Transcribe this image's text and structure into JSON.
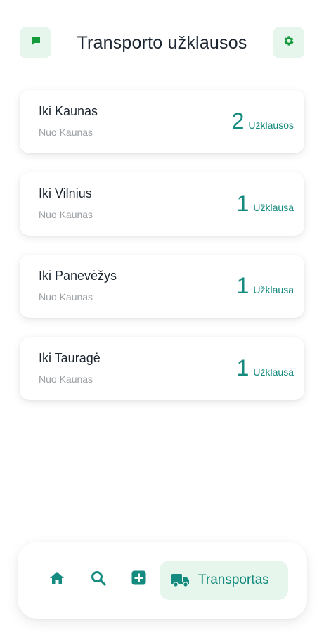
{
  "header": {
    "title": "Transporto užklausos",
    "left_icon": "chat-icon",
    "right_icon": "gear-icon"
  },
  "colors": {
    "accent": "#158a7e",
    "icon_green": "#159a3c",
    "pill_bg": "#e7f6ec"
  },
  "requests": [
    {
      "destination": "Iki Kaunas",
      "origin": "Nuo Kaunas",
      "count": "2",
      "unit": "Užklausos"
    },
    {
      "destination": "Iki Vilnius",
      "origin": "Nuo Kaunas",
      "count": "1",
      "unit": "Užklausa"
    },
    {
      "destination": "Iki Panevėžys",
      "origin": "Nuo Kaunas",
      "count": "1",
      "unit": "Užklausa"
    },
    {
      "destination": "Iki Tauragė",
      "origin": "Nuo Kaunas",
      "count": "1",
      "unit": "Užklausa"
    }
  ],
  "nav": {
    "home_icon": "home-icon",
    "search_icon": "search-icon",
    "add_icon": "plus-square-icon",
    "active_icon": "truck-icon",
    "active_label": "Transportas"
  }
}
